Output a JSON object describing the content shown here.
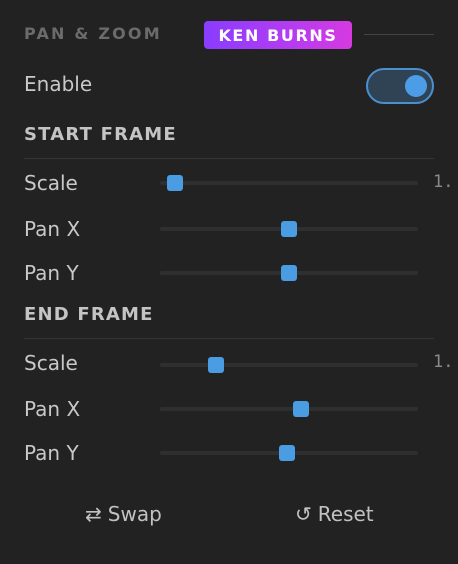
{
  "header": {
    "title": "PAN & ZOOM",
    "badge": "KEN BURNS"
  },
  "enable": {
    "label": "Enable",
    "value": true
  },
  "start_frame": {
    "title": "START FRAME",
    "scale": {
      "label": "Scale",
      "value_text": "1.",
      "position": 0.03
    },
    "pan_x": {
      "label": "Pan X",
      "position": 0.5
    },
    "pan_y": {
      "label": "Pan Y",
      "position": 0.5
    }
  },
  "end_frame": {
    "title": "END FRAME",
    "scale": {
      "label": "Scale",
      "value_text": "1.",
      "position": 0.2
    },
    "pan_x": {
      "label": "Pan X",
      "position": 0.55
    },
    "pan_y": {
      "label": "Pan Y",
      "position": 0.49
    }
  },
  "footer": {
    "swap_icon": "⇄",
    "swap_label": "Swap",
    "reset_icon": "↺",
    "reset_label": "Reset"
  },
  "colors": {
    "accent": "#4a9ce3",
    "badge_start": "#8a3cff",
    "badge_end": "#d63ae0"
  }
}
